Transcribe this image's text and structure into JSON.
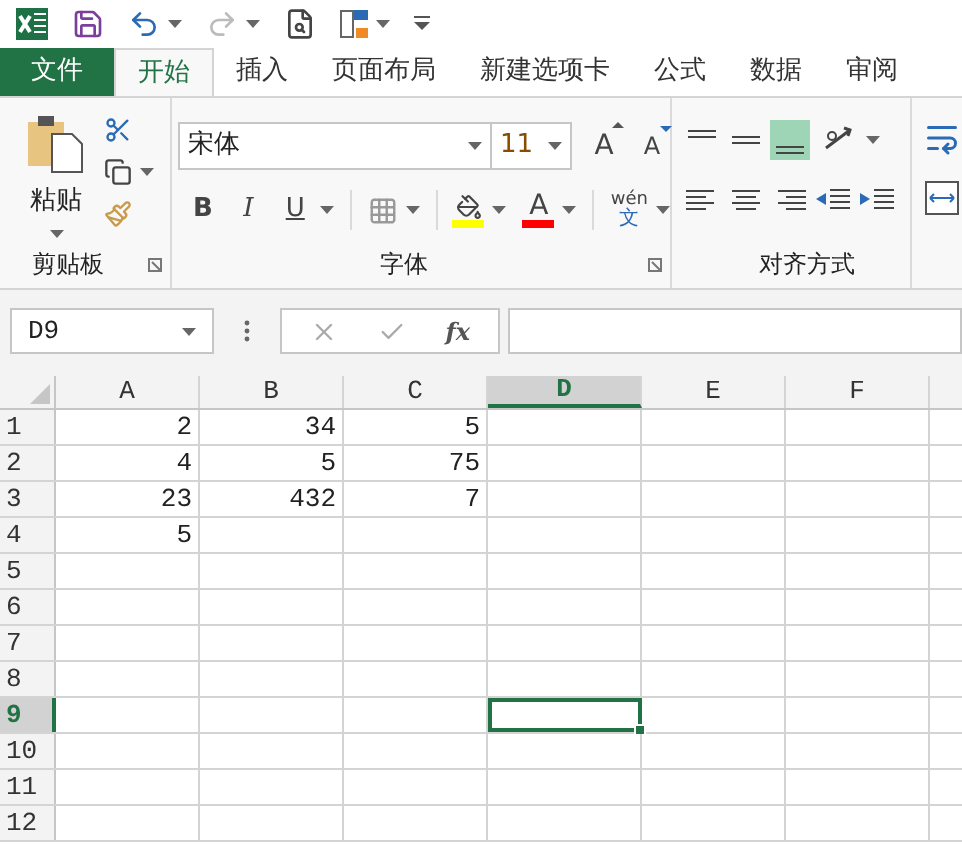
{
  "tabs": [
    {
      "label": "文件",
      "kind": "file",
      "selected": false
    },
    {
      "label": "开始",
      "kind": "tab",
      "selected": true
    },
    {
      "label": "插入",
      "kind": "tab",
      "selected": false
    },
    {
      "label": "页面布局",
      "kind": "tab",
      "selected": false
    },
    {
      "label": "新建选项卡",
      "kind": "tab",
      "selected": false
    },
    {
      "label": "公式",
      "kind": "tab",
      "selected": false
    },
    {
      "label": "数据",
      "kind": "tab",
      "selected": false
    },
    {
      "label": "审阅",
      "kind": "tab",
      "selected": false
    }
  ],
  "ribbon": {
    "paste_label": "粘贴",
    "clipboard_label": "剪贴板",
    "font_name": "宋体",
    "font_size": "11",
    "grow_font": "A",
    "shrink_font": "A",
    "bold": "B",
    "italic": "I",
    "underline": "U",
    "font_color": "A",
    "phonetic_top": "wén",
    "phonetic_bottom": "文",
    "font_label": "字体",
    "alignment_label": "对齐方式",
    "bottom_align_on": true
  },
  "formula_bar": {
    "name_box": "D9",
    "fx": "fx"
  },
  "columns": [
    {
      "label": "A",
      "selected": false
    },
    {
      "label": "B",
      "selected": false
    },
    {
      "label": "C",
      "selected": false
    },
    {
      "label": "D",
      "selected": true
    },
    {
      "label": "E",
      "selected": false
    },
    {
      "label": "F",
      "selected": false
    }
  ],
  "rows": [
    {
      "label": "1",
      "selected": false,
      "values": [
        "2",
        "34",
        "5"
      ]
    },
    {
      "label": "2",
      "selected": false,
      "values": [
        "4",
        "5",
        "75"
      ]
    },
    {
      "label": "3",
      "selected": false,
      "values": [
        "23",
        "432",
        "7"
      ]
    },
    {
      "label": "4",
      "selected": false,
      "values": [
        "5"
      ]
    },
    {
      "label": "5",
      "selected": false
    },
    {
      "label": "6",
      "selected": false
    },
    {
      "label": "7",
      "selected": false
    },
    {
      "label": "8",
      "selected": false
    },
    {
      "label": "9",
      "selected": true
    },
    {
      "label": "10",
      "selected": false
    },
    {
      "label": "11",
      "selected": false
    },
    {
      "label": "12",
      "selected": false
    }
  ]
}
